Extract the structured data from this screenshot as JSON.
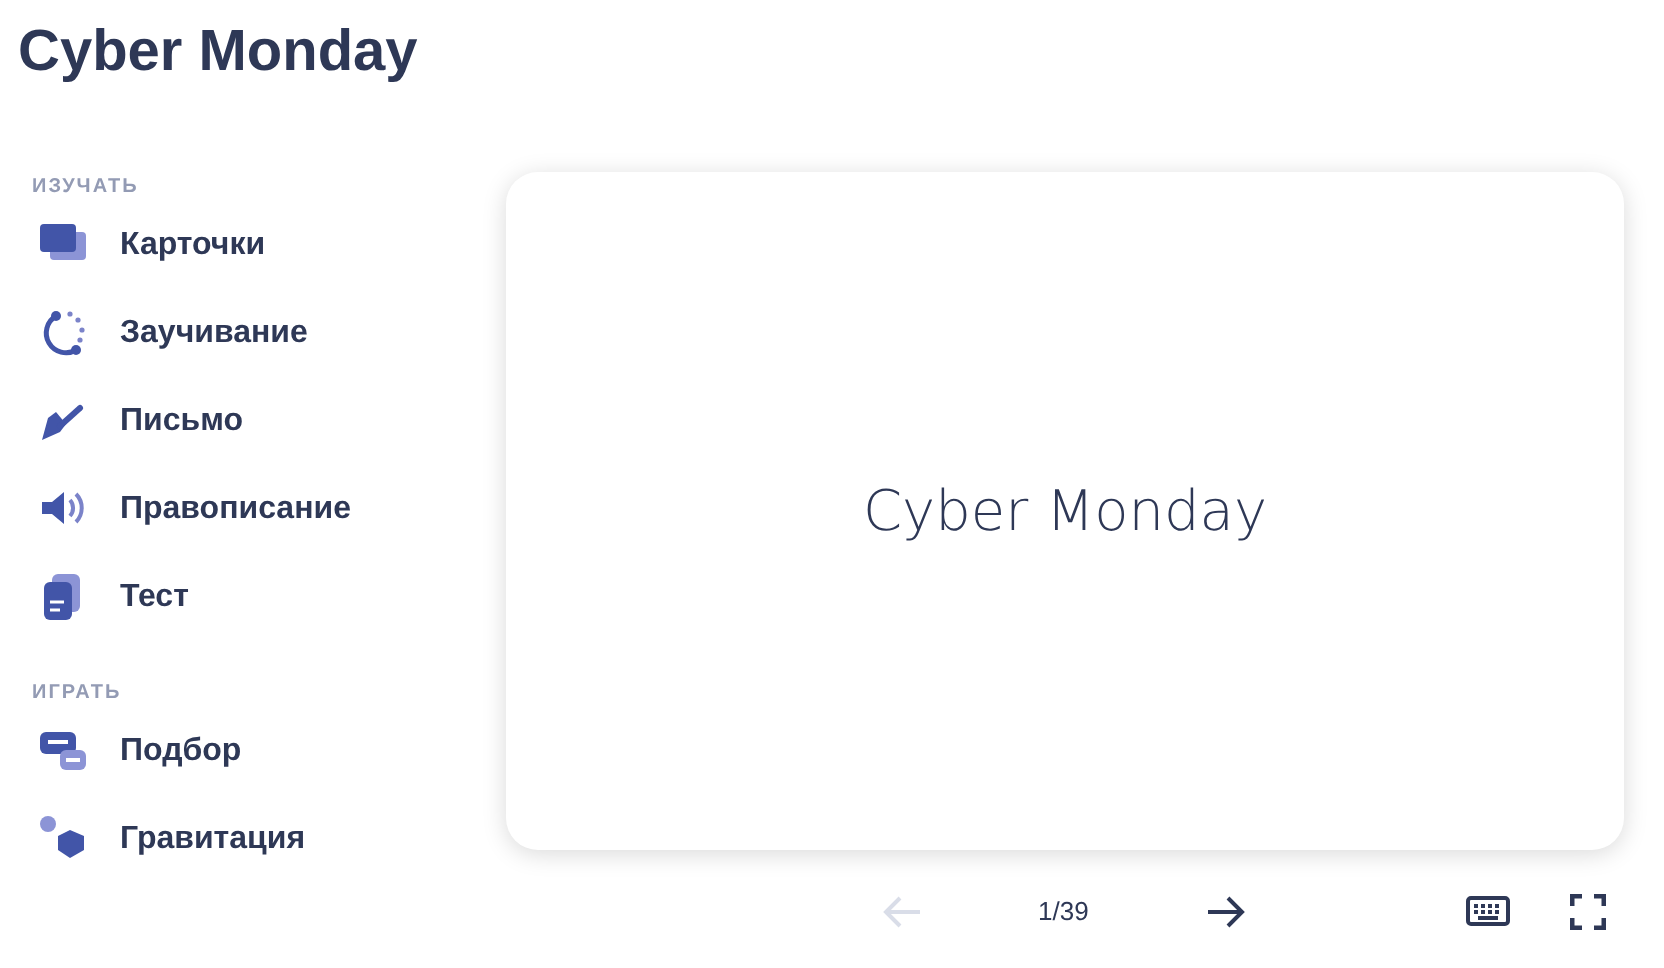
{
  "title": "Cyber Monday",
  "sidebar": {
    "sections": [
      {
        "heading": "ИЗУЧАТЬ",
        "items": [
          {
            "label": "Карточки",
            "kind": "cards"
          },
          {
            "label": "Заучивание",
            "kind": "learn"
          },
          {
            "label": "Письмо",
            "kind": "write"
          },
          {
            "label": "Правописание",
            "kind": "spell"
          },
          {
            "label": "Тест",
            "kind": "test"
          }
        ]
      },
      {
        "heading": "ИГРАТЬ",
        "items": [
          {
            "label": "Подбор",
            "kind": "match"
          },
          {
            "label": "Гравитация",
            "kind": "gravity"
          }
        ]
      }
    ]
  },
  "card": {
    "term": "Cyber Monday"
  },
  "controls": {
    "prev_disabled": true,
    "next_disabled": false,
    "counter": "1/39"
  }
}
